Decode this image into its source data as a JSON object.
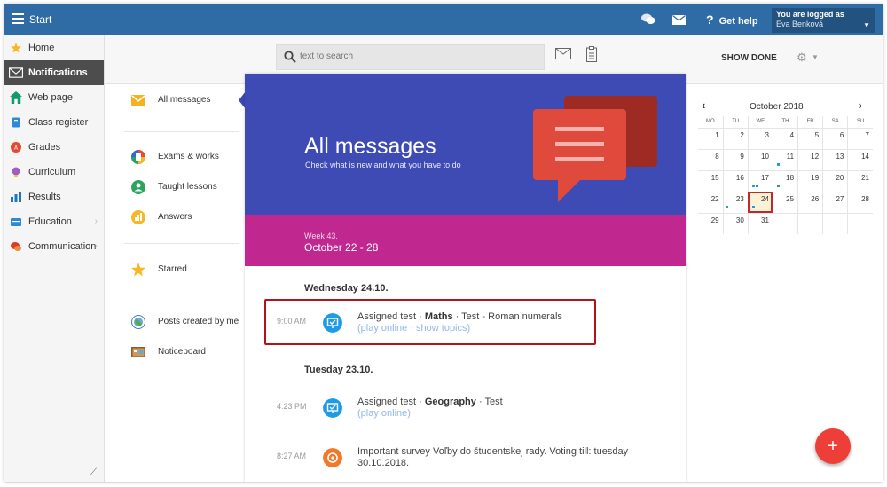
{
  "topbar": {
    "title": "Start",
    "help_label": "Get help",
    "user_line1": "You are logged as",
    "user_line2": "Eva Benková"
  },
  "sidebar": {
    "items": [
      {
        "label": "Home",
        "icon": "star-icon"
      },
      {
        "label": "Notifications",
        "icon": "envelope-icon"
      },
      {
        "label": "Web page",
        "icon": "house-icon"
      },
      {
        "label": "Class register",
        "icon": "book-icon"
      },
      {
        "label": "Grades",
        "icon": "grades-icon"
      },
      {
        "label": "Curriculum",
        "icon": "bulb-icon"
      },
      {
        "label": "Results",
        "icon": "bar-chart-icon"
      },
      {
        "label": "Education",
        "icon": "folder-icon"
      },
      {
        "label": "Communication",
        "icon": "chat-bubbles-icon"
      }
    ]
  },
  "toolbar": {
    "search_placeholder": "text to search",
    "show_done_label": "SHOW DONE"
  },
  "filters": {
    "items": [
      {
        "label": "All messages"
      },
      {
        "label": "Exams & works"
      },
      {
        "label": "Taught lessons"
      },
      {
        "label": "Answers"
      },
      {
        "label": "Starred"
      },
      {
        "label": "Posts created by me"
      },
      {
        "label": "Noticeboard"
      }
    ]
  },
  "hero": {
    "title": "All messages",
    "subtitle": "Check what is new and what you have to do"
  },
  "week": {
    "label": "Week 43.",
    "range": "October 22 - 28"
  },
  "days": [
    {
      "label": "Wednesday 24.10.",
      "messages": [
        {
          "time": "9:00 AM",
          "prefix": "Assigned test · ",
          "subject": "Maths",
          "suffix": " · Test - Roman numerals",
          "links": "(play online · show topics)"
        }
      ]
    },
    {
      "label": "Tuesday 23.10.",
      "messages": [
        {
          "time": "4:23 PM",
          "prefix": "Assigned test · ",
          "subject": "Geography",
          "suffix": " · Test",
          "links": "(play online)"
        },
        {
          "time": "8:27 AM",
          "prefix": "Important survey Voľby do študentskej rady. Voting till: tuesday 30.10.2018.",
          "subject": "",
          "suffix": "",
          "links": ""
        }
      ]
    }
  ],
  "calendar": {
    "month": "October 2018",
    "prev": "‹",
    "next": "›",
    "weekdays": [
      "MO",
      "TU",
      "WE",
      "TH",
      "FR",
      "SA",
      "SU"
    ],
    "weeks": [
      [
        "1",
        "2",
        "3",
        "4",
        "5",
        "6",
        "7"
      ],
      [
        "8",
        "9",
        "10",
        "11",
        "12",
        "13",
        "14"
      ],
      [
        "15",
        "16",
        "17",
        "18",
        "19",
        "20",
        "21"
      ],
      [
        "22",
        "23",
        "24",
        "25",
        "26",
        "27",
        "28"
      ],
      [
        "29",
        "30",
        "31",
        "",
        "",
        "",
        ""
      ]
    ],
    "today": "24"
  },
  "fab_label": "+",
  "colors": {
    "topbar": "#2f6ca6",
    "hero": "#3e4bb5",
    "week_band": "#c0288f",
    "highlight": "#b3121b",
    "fab": "#ed3f37"
  }
}
